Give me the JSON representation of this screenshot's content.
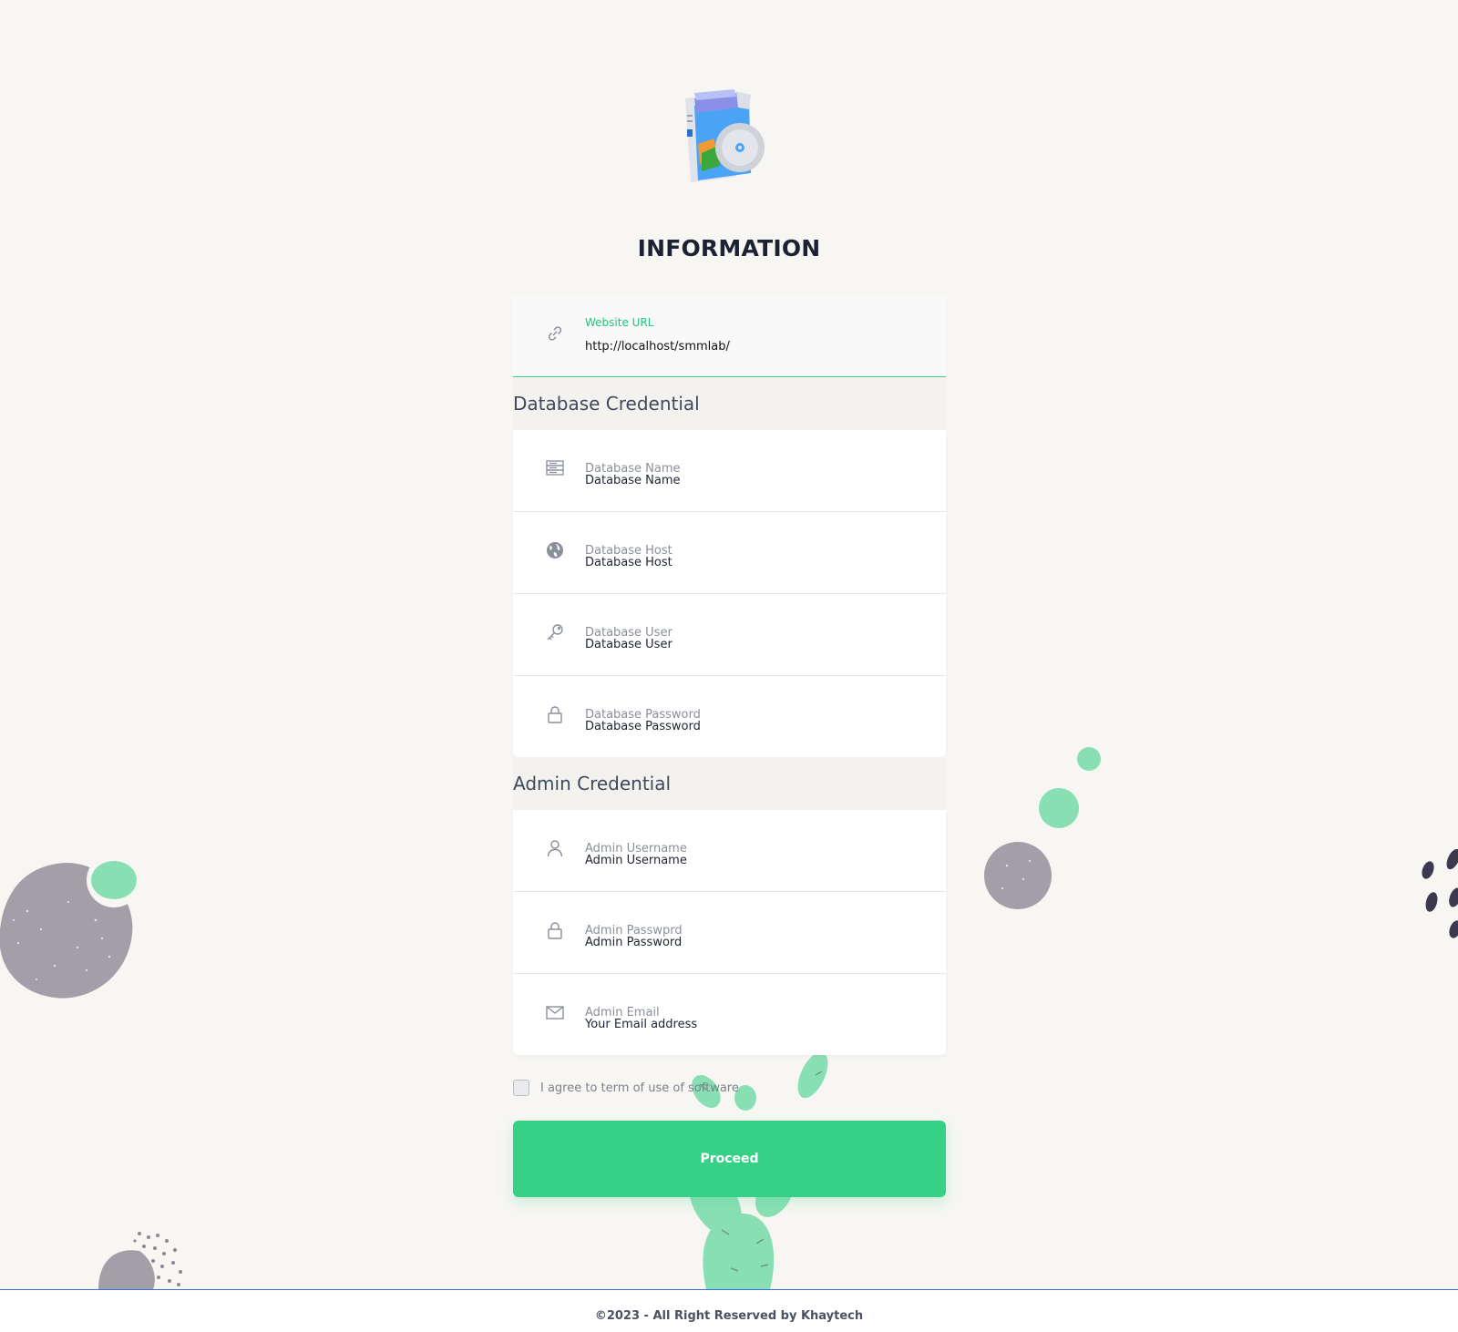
{
  "page": {
    "title": "INFORMATION"
  },
  "website_url": {
    "label": "Website URL",
    "value": "http://localhost/smmlab/"
  },
  "database_section": {
    "heading": "Database Credential",
    "fields": [
      {
        "label": "Database Name",
        "placeholder": "Database Name",
        "icon": "database-icon"
      },
      {
        "label": "Database Host",
        "placeholder": "Database Host",
        "icon": "globe-icon"
      },
      {
        "label": "Database User",
        "placeholder": "Database User",
        "icon": "key-icon"
      },
      {
        "label": "Database Password",
        "placeholder": "Database Password",
        "icon": "lock-icon"
      }
    ]
  },
  "admin_section": {
    "heading": "Admin Credential",
    "fields": [
      {
        "label": "Admin Username",
        "placeholder": "Admin Username",
        "icon": "user-icon"
      },
      {
        "label": "Admin Passwprd",
        "placeholder": "Admin Password",
        "icon": "lock-icon"
      },
      {
        "label": "Admin Email",
        "placeholder": "Your Email address",
        "icon": "envelope-icon"
      }
    ]
  },
  "agreement": {
    "label": "I agree to term of use of software",
    "checked": false
  },
  "proceed_button": {
    "label": "Proceed"
  },
  "footer": {
    "text": "©2023 - All Right Reserved by Khaytech"
  },
  "colors": {
    "accent": "#37d087",
    "background": "#f7f6f2",
    "heading": "#1c2233",
    "footer_border": "#3a6fd8"
  }
}
